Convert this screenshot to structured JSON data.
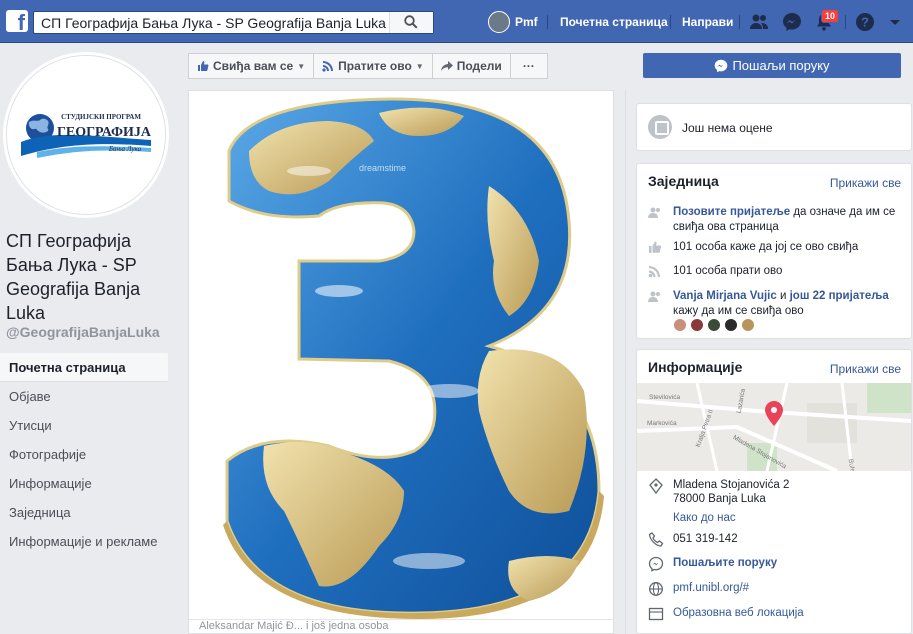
{
  "topbar": {
    "search_value": "СП Географија Бања Лука - SP Geografija Banja Luka",
    "profile_name": "Pmf",
    "home_label": "Почетна страница",
    "create_label": "Направи",
    "notifications_count": "10"
  },
  "page": {
    "logo_line1": "СТУДИЈСКИ ПРОГРАМ",
    "logo_line2": "ГЕОГРАФИЈА",
    "logo_line3": "Бања Лука",
    "name": "СП Географија Бања Лука - SP Geografija Banja Luka",
    "handle": "@GeografijaBanjaLuka"
  },
  "leftnav": {
    "items": [
      {
        "label": "Почетна страница"
      },
      {
        "label": "Објаве"
      },
      {
        "label": "Утисци"
      },
      {
        "label": "Фотографије"
      },
      {
        "label": "Информације"
      },
      {
        "label": "Заједница"
      },
      {
        "label": "Информације и рекламе"
      }
    ]
  },
  "actions": {
    "like": "Свиђа вам се",
    "follow": "Пратите ово",
    "share": "Подели",
    "more": "···",
    "send_message": "Пошаљи поруку"
  },
  "post": {
    "watermark": "dreamstime",
    "footer": "Aleksandar Majić Đ... i još jedna osoba"
  },
  "rating": {
    "text": "Још нема оцене"
  },
  "community": {
    "title": "Заједница",
    "see_all": "Прикажи све",
    "invite_link": "Позовите пријатеље",
    "invite_rest": " да означе да им се свиђа ова страница",
    "likes": "101 особа каже да јој се ово свиђа",
    "follows": "101 особа прати ово",
    "friends_link": "Vanja Mirjana Vujic",
    "friends_and": " и ",
    "friends_more": "још 22 пријатеља",
    "friends_rest": "кажу да им се свиђа ово"
  },
  "info": {
    "title": "Информације",
    "see_all": "Прикажи све",
    "map_streets": [
      "Stevilovića",
      "Markovića",
      "Kralja Petra II",
      "Mladena Stojanovića",
      "Lazarića",
      "Bulevar"
    ],
    "address_line1": "Mladena Stojanovića 2",
    "address_line2": "78000 Banja Luka",
    "directions": "Како до нас",
    "phone": "051 319-142",
    "send_message": "Пошаљите поруку",
    "website": "pmf.unibl.org/#",
    "category": "Образовна веб локација"
  },
  "colors": {
    "brand_blue": "#4267b2",
    "link_blue": "#365899",
    "badge_red": "#fa3e3e",
    "ocean": "#2a7bc4",
    "land": "#d9c48a"
  }
}
